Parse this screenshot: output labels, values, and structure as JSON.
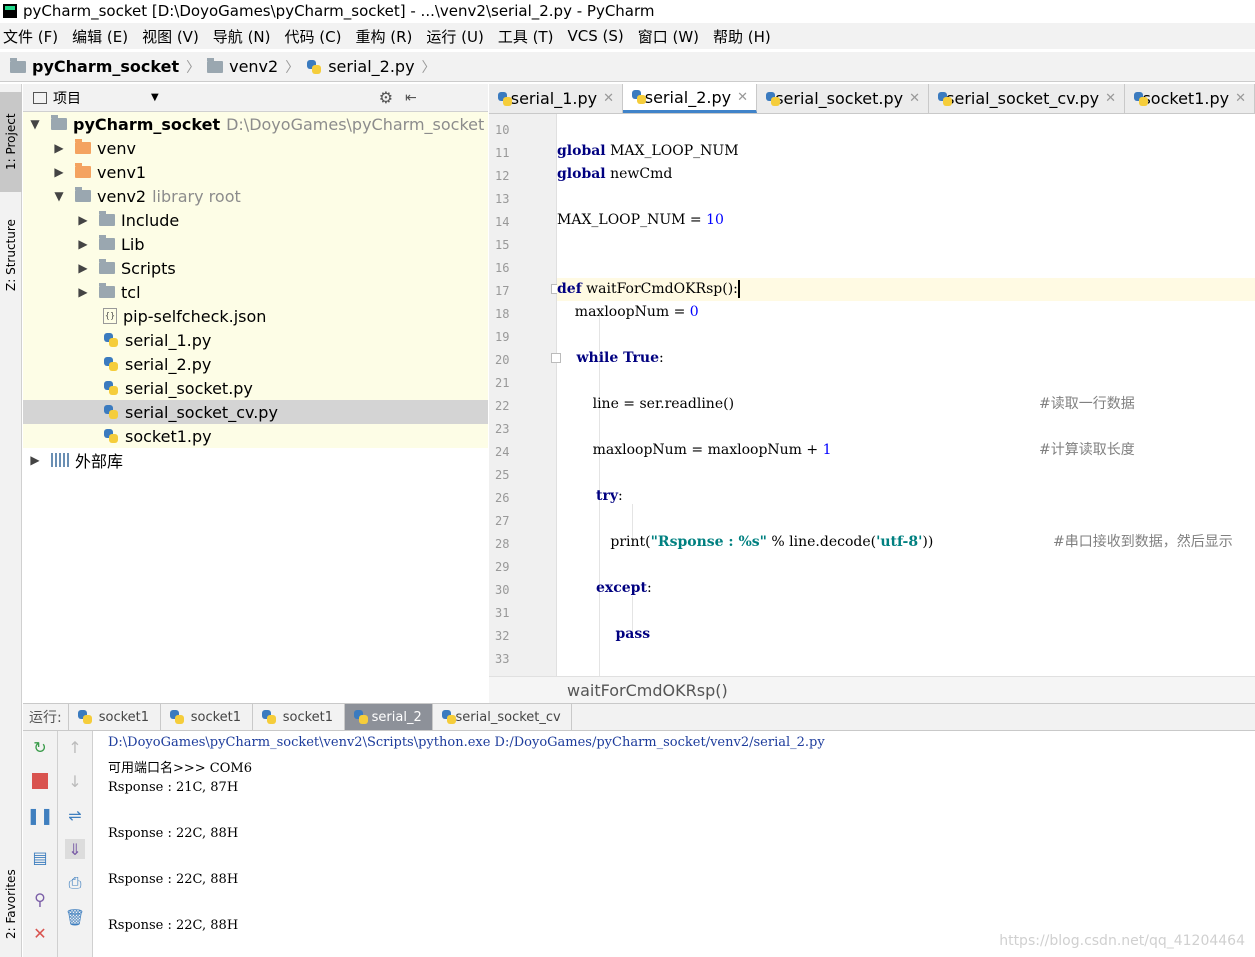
{
  "window": {
    "title": "pyCharm_socket [D:\\DoyoGames\\pyCharm_socket] - ...\\venv2\\serial_2.py - PyCharm"
  },
  "menu": [
    "文件 (F)",
    "编辑 (E)",
    "视图 (V)",
    "导航 (N)",
    "代码 (C)",
    "重构 (R)",
    "运行 (U)",
    "工具 (T)",
    "VCS (S)",
    "窗口 (W)",
    "帮助 (H)"
  ],
  "navbar": {
    "project": "pyCharm_socket",
    "folder": "venv2",
    "file": "serial_2.py"
  },
  "side_tabs": {
    "project": "1: Project",
    "structure": "Z: Structure",
    "favorites": "2: Favorites"
  },
  "project_panel": {
    "title": "项目",
    "root": {
      "name": "pyCharm_socket",
      "path": "D:\\DoyoGames\\pyCharm_socket"
    },
    "items": [
      {
        "label": "venv",
        "hint": ""
      },
      {
        "label": "venv1",
        "hint": ""
      },
      {
        "label": "venv2",
        "hint": "library root"
      },
      {
        "label": "Include",
        "hint": ""
      },
      {
        "label": "Lib",
        "hint": ""
      },
      {
        "label": "Scripts",
        "hint": ""
      },
      {
        "label": "tcl",
        "hint": ""
      },
      {
        "label": "pip-selfcheck.json",
        "hint": ""
      },
      {
        "label": "serial_1.py",
        "hint": ""
      },
      {
        "label": "serial_2.py",
        "hint": ""
      },
      {
        "label": "serial_socket.py",
        "hint": ""
      },
      {
        "label": "serial_socket_cv.py",
        "hint": ""
      },
      {
        "label": "socket1.py",
        "hint": ""
      },
      {
        "label": "外部库",
        "hint": ""
      }
    ]
  },
  "editor_tabs": [
    "serial_1.py",
    "serial_2.py",
    "serial_socket.py",
    "serial_socket_cv.py",
    "socket1.py"
  ],
  "active_tab": "serial_2.py",
  "code": {
    "line_numbers": [
      "10",
      "11",
      "12",
      "13",
      "14",
      "15",
      "16",
      "17",
      "18",
      "19",
      "20",
      "21",
      "22",
      "23",
      "24",
      "25",
      "26",
      "27",
      "28",
      "29",
      "30",
      "31",
      "32",
      "33"
    ],
    "l11_kw": "global",
    "l11_rest": " MAX_LOOP_NUM",
    "l12_kw": "global",
    "l12_rest": " newCmd",
    "l14_a": "MAX_LOOP_NUM = ",
    "l14_num": "10",
    "l17_kw": "def",
    "l17_rest": " waitForCmdOKRsp():",
    "l18_a": "    maxloopNum = ",
    "l18_num": "0",
    "l20_kw": "    while True",
    "l20_rest": ":",
    "l22_a": "        line = ser.readline()",
    "l22_cmt": "#读取一行数据",
    "l24_a": "        maxloopNum = maxloopNum + ",
    "l24_num": "1",
    "l24_cmt": "#计算读取长度",
    "l26_kw": "        try",
    "l26_rest": ":",
    "l28_a": "            print(",
    "l28_str": "\"Rsponse : %s\"",
    "l28_b": " % line.decode(",
    "l28_str2": "'utf-8'",
    "l28_c": "))",
    "l28_cmt": "#串口接收到数据，然后显示",
    "l30_kw": "        except",
    "l30_rest": ":",
    "l32_kw": "            pass"
  },
  "editor_breadcrumb": "waitForCmdOKRsp()",
  "run": {
    "label": "运行:",
    "tabs": [
      "socket1",
      "socket1",
      "socket1",
      "serial_2",
      "serial_socket_cv"
    ],
    "active": "serial_2",
    "console": [
      "D:\\DoyoGames\\pyCharm_socket\\venv2\\Scripts\\python.exe D:/DoyoGames/pyCharm_socket/venv2/serial_2.py",
      "可用端口名>>> COM6",
      "Rsponse : 21C, 87H",
      "",
      "Rsponse : 22C, 88H",
      "",
      "Rsponse : 22C, 88H",
      "",
      "Rsponse : 22C, 88H"
    ]
  },
  "watermark": "https://blog.csdn.net/qq_41204464",
  "colors": {
    "accent": "#4083c9",
    "keyword": "#000080",
    "number": "#0000ff",
    "string": "#008080",
    "comment": "#808080"
  }
}
